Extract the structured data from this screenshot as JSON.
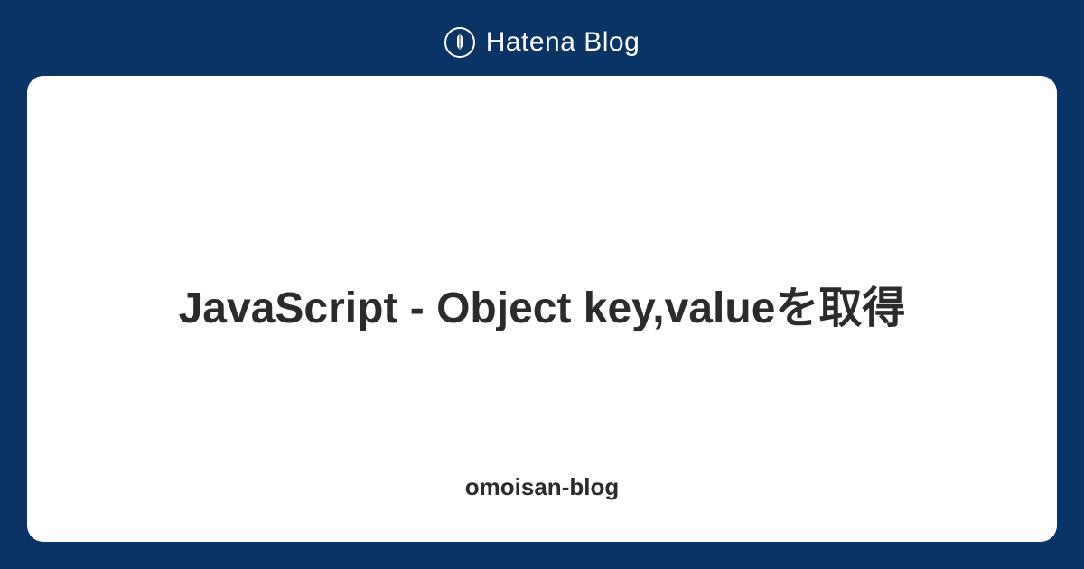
{
  "header": {
    "brand_name": "Hatena Blog"
  },
  "card": {
    "title": "JavaScript - Object key,valueを取得",
    "blog_name": "omoisan-blog"
  }
}
